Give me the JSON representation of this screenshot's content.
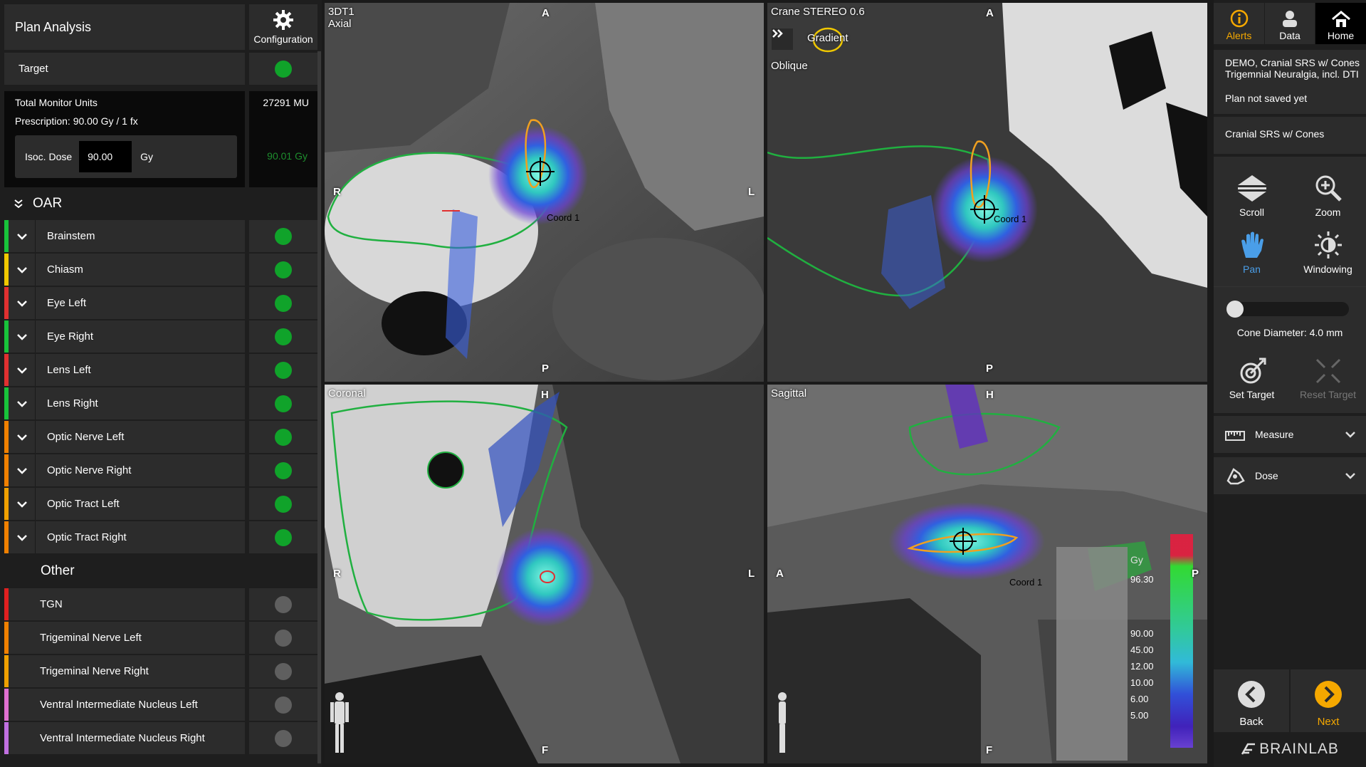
{
  "left": {
    "title": "Plan Analysis",
    "config_label": "Configuration",
    "target_label": "Target",
    "mu_label": "Total Monitor Units",
    "mu_value": "27291 MU",
    "prescription": "Prescription: 90.00 Gy / 1 fx",
    "isoc_label": "Isoc. Dose",
    "isoc_value": "90.00",
    "isoc_unit": "Gy",
    "isoc_readout": "90.01 Gy",
    "oar_header": "OAR",
    "other_header": "Other",
    "oar": [
      {
        "name": "Brainstem",
        "color": "#18c23a"
      },
      {
        "name": "Chiasm",
        "color": "#f0c800"
      },
      {
        "name": "Eye Left",
        "color": "#e03030"
      },
      {
        "name": "Eye Right",
        "color": "#18c23a"
      },
      {
        "name": "Lens Left",
        "color": "#e03030"
      },
      {
        "name": "Lens Right",
        "color": "#18c23a"
      },
      {
        "name": "Optic Nerve Left",
        "color": "#f08000"
      },
      {
        "name": "Optic Nerve Right",
        "color": "#f08000"
      },
      {
        "name": "Optic Tract Left",
        "color": "#f0a000"
      },
      {
        "name": "Optic Tract Right",
        "color": "#f08000"
      }
    ],
    "other": [
      {
        "name": "TGN",
        "color": "#e02020"
      },
      {
        "name": "Trigeminal Nerve Left",
        "color": "#f08000"
      },
      {
        "name": "Trigeminal Nerve Right",
        "color": "#f0a000"
      },
      {
        "name": "Ventral Intermediate Nucleus Left",
        "color": "#e070d0"
      },
      {
        "name": "Ventral Intermediate Nucleus Right",
        "color": "#c070e0"
      }
    ]
  },
  "views": {
    "axial": {
      "line1": "3DT1",
      "line2": "Axial",
      "top": "A",
      "bottom": "P",
      "left": "R",
      "right": "L",
      "coord": "Coord 1"
    },
    "oblique": {
      "line1": "Crane STEREO  0.6",
      "gradient": "Gradient",
      "line2": "Oblique",
      "top": "A",
      "bottom": "P",
      "coord": "Coord 1"
    },
    "coronal": {
      "line1": "Coronal",
      "top": "H",
      "bottom": "F",
      "left": "R",
      "right": "L"
    },
    "sagittal": {
      "line1": "Sagittal",
      "top": "H",
      "bottom": "F",
      "left": "A",
      "right": "P",
      "coord": "Coord 1"
    }
  },
  "legend": {
    "unit": "Gy",
    "values": [
      "96.30",
      "90.00",
      "45.00",
      "12.00",
      "10.00",
      "6.00",
      "5.00"
    ]
  },
  "right": {
    "alerts": "Alerts",
    "data": "Data",
    "home": "Home",
    "plan_line1": "DEMO, Cranial SRS w/ Cones",
    "plan_line2": "Trigemnial Neuralgia, incl. DTI",
    "plan_status": "Plan not saved yet",
    "plan_type": "Cranial SRS w/ Cones",
    "scroll": "Scroll",
    "zoom": "Zoom",
    "pan": "Pan",
    "windowing": "Windowing",
    "cone": "Cone Diameter: 4.0 mm",
    "set_target": "Set Target",
    "reset_target": "Reset Target",
    "measure": "Measure",
    "dose": "Dose",
    "back": "Back",
    "next": "Next",
    "brand": "BRAINLAB"
  },
  "colors": {
    "accent": "#f5a800",
    "pan": "#4a9ee8",
    "ok": "#10a32a"
  }
}
